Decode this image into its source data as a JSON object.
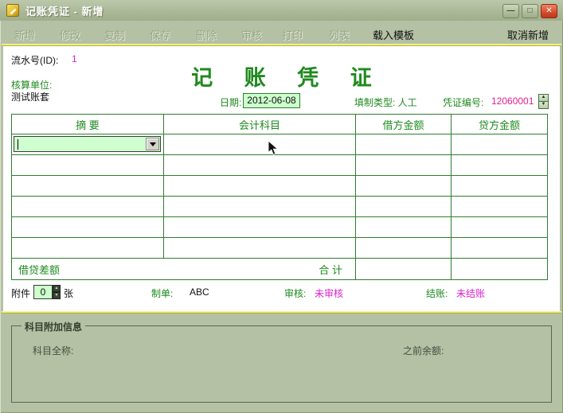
{
  "window": {
    "title": "记账凭证 - 新增",
    "minimize_glyph": "—",
    "maximize_glyph": "□",
    "close_glyph": "✕"
  },
  "toolbar": {
    "items": [
      {
        "label": "新增",
        "enabled": false
      },
      {
        "label": "修改",
        "enabled": false
      },
      {
        "label": "复制",
        "enabled": false
      },
      {
        "label": "保存",
        "enabled": false
      },
      {
        "label": "删除",
        "enabled": false
      },
      {
        "label": "审核",
        "enabled": false
      },
      {
        "label": "打印",
        "enabled": false
      },
      {
        "label": "列表",
        "enabled": false
      },
      {
        "label": "载入模板",
        "enabled": true
      }
    ],
    "cancel_label": "取消新增"
  },
  "header": {
    "serial_label": "流水号(ID):",
    "serial_value": "1",
    "unit_label": "核算单位:",
    "unit_value": "测试账套",
    "form_title": "记 账 凭 证",
    "date_label": "日期:",
    "date_value": "2012-06-08",
    "fill_type_label": "填制类型: 人工",
    "voucher_no_label": "凭证编号:",
    "voucher_no_value": "12060001"
  },
  "table": {
    "headers": [
      "摘  要",
      "会计科目",
      "借方金额",
      "贷方金额"
    ],
    "empty_row_count": 6,
    "footer": {
      "difference_label": "借贷差额",
      "total_label": "合  计"
    }
  },
  "status": {
    "attachment_label": "附件",
    "attachment_value": "0",
    "attachment_unit": "张",
    "maker_label": "制单:",
    "maker_value": "ABC",
    "audit_label": "审核:",
    "audit_value": "未审核",
    "settle_label": "结账:",
    "settle_value": "未结账"
  },
  "extra": {
    "group_title": "科目附加信息",
    "full_name_label": "科目全称:",
    "prev_balance_label": "之前余额:"
  },
  "colors": {
    "sage_bg": "#b5c1a4",
    "accent_green": "#1e8a1e",
    "magenta": "#dd22cc",
    "voucher_number_color": "#e0218a",
    "light_green_bg": "#ccffcc",
    "table_border": "#2f7d2f",
    "yellow_line": "#f2ee8a"
  }
}
